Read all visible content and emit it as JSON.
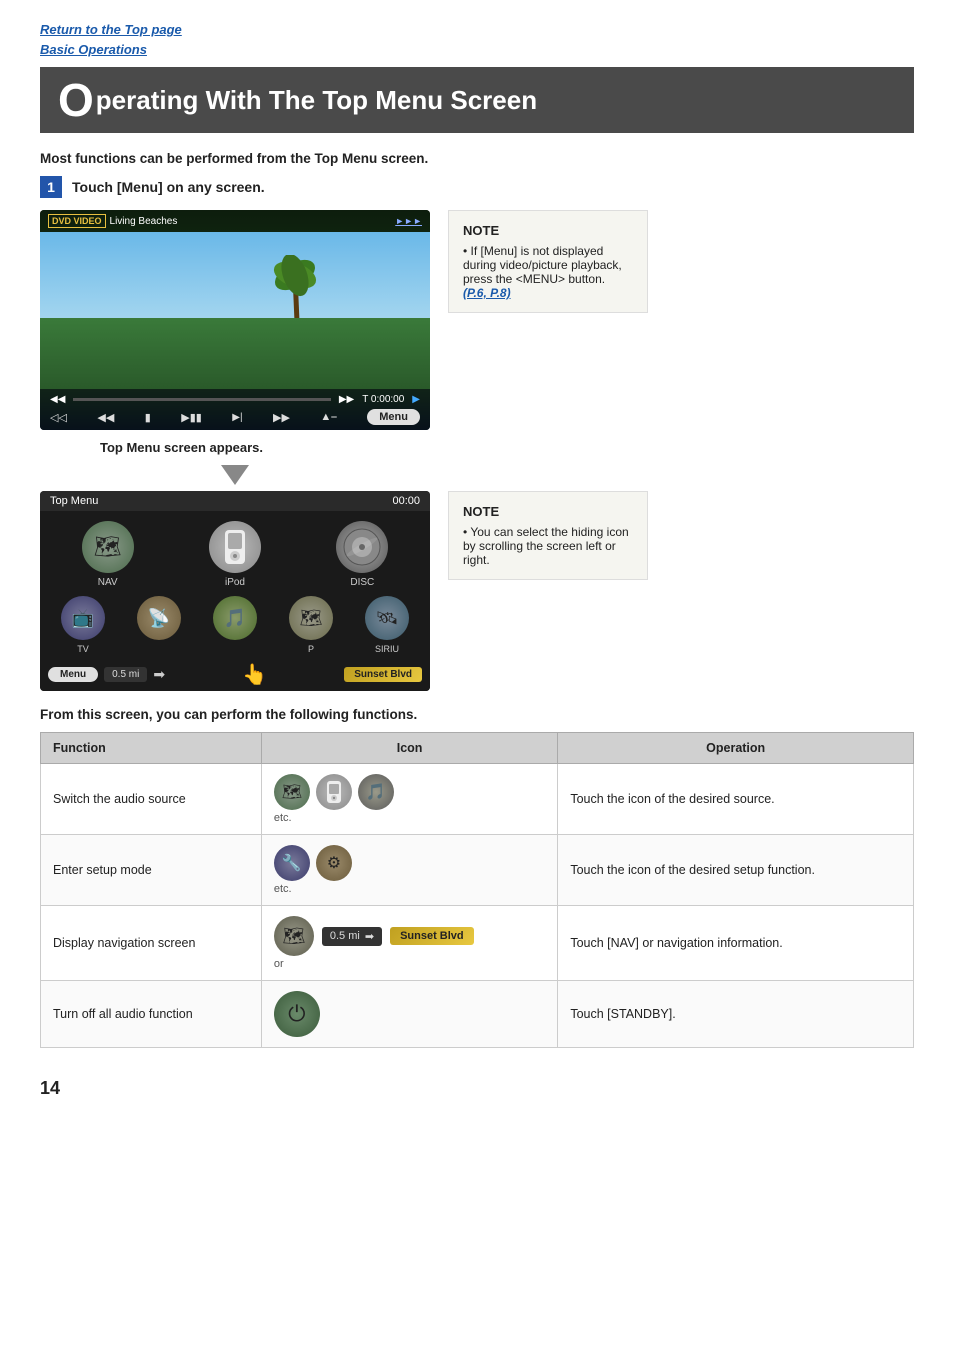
{
  "breadcrumb": {
    "return_link": "Return to the Top page",
    "basic_ops_link": "Basic Operations"
  },
  "page_title": {
    "big_o": "O",
    "rest": "perating With The Top Menu Screen"
  },
  "intro": "Most functions can be performed from the Top Menu screen.",
  "step1": {
    "number": "1",
    "label": "Touch [Menu] on any screen."
  },
  "dvd_screen": {
    "logo": "DVD VIDEO",
    "title": "Living Beaches",
    "time": "T 0:00:00",
    "menu_btn": "Menu"
  },
  "note1": {
    "title": "NOTE",
    "text": "If [Menu] is not displayed during video/picture playback, press the <MENU> button.",
    "link": "(P.6, P.8)"
  },
  "appears_text": "Top Menu screen appears.",
  "topmenu_screen": {
    "label": "Top Menu",
    "time": "00:00",
    "icons_row1": [
      {
        "label": "NAV"
      },
      {
        "label": "iPod"
      },
      {
        "label": "DISC"
      }
    ],
    "icons_row2": [
      {
        "label": "TV"
      },
      {
        "label": ""
      },
      {
        "label": ""
      },
      {
        "label": "P"
      },
      {
        "label": "SIRIU"
      }
    ],
    "nav_info": "0.5 mi",
    "sunset": "Sunset Blvd"
  },
  "note2": {
    "title": "NOTE",
    "text": "You can select the hiding icon by scrolling the screen left or right."
  },
  "from_screen_text": "From this screen, you can perform the following functions.",
  "table": {
    "headers": [
      "Function",
      "Icon",
      "Operation"
    ],
    "rows": [
      {
        "function": "Switch the audio source",
        "icon_desc": "etc.",
        "operation": "Touch the icon of the desired source."
      },
      {
        "function": "Enter setup mode",
        "icon_desc": "etc.",
        "operation": "Touch the icon of the desired setup function."
      },
      {
        "function": "Display navigation screen",
        "icon_desc": "or",
        "operation": "Touch [NAV] or navigation information."
      },
      {
        "function": "Turn off all audio function",
        "icon_desc": "",
        "operation": "Touch [STANDBY]."
      }
    ]
  },
  "page_number": "14"
}
